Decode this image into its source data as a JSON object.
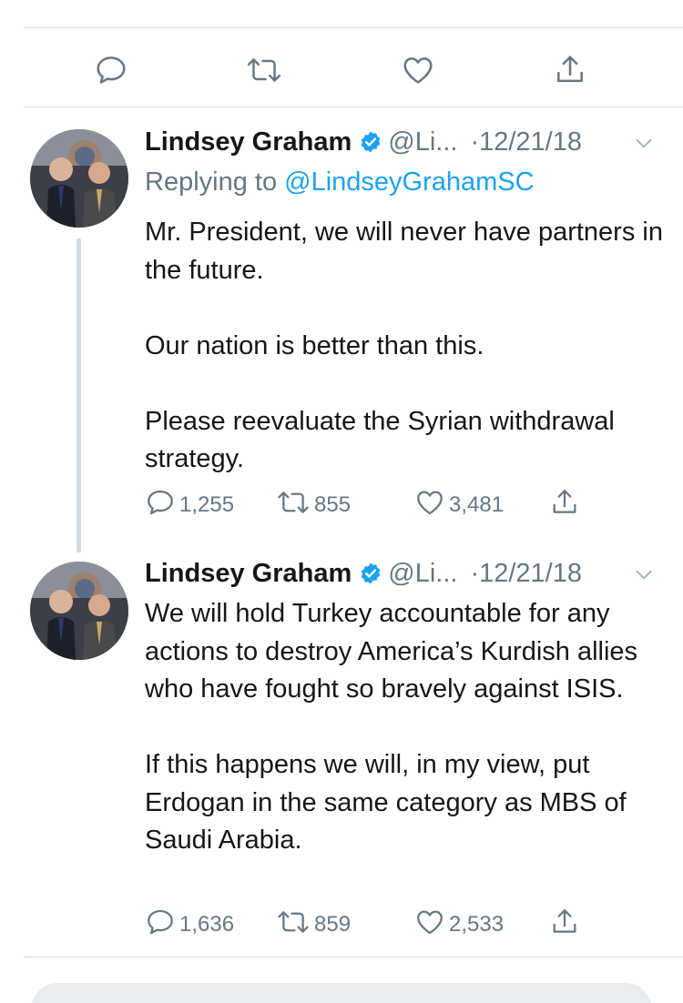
{
  "top_actions": {
    "icons": [
      "reply-icon",
      "retweet-icon",
      "like-icon",
      "share-icon"
    ]
  },
  "tweets": [
    {
      "name": "Lindsey Graham",
      "handle": "@Li...",
      "dot": "·",
      "date": "12/21/18",
      "replying_prefix": "Replying to ",
      "replying_to": "@LindseyGrahamSC",
      "paragraphs": [
        "Mr. President, we will never have partners in the future.",
        "Our nation is better than this.",
        "Please reevaluate the Syrian withdrawal strategy."
      ],
      "replies": "1,255",
      "retweets": "855",
      "likes": "3,481"
    },
    {
      "name": "Lindsey Graham",
      "handle": "@Li...",
      "dot": "·",
      "date": "12/21/18",
      "paragraphs": [
        "We will hold Turkey accountable for any actions to destroy America’s Kurdish allies who have fought so bravely against ISIS.",
        "If this happens we will, in my view, put Erdogan in the same category as MBS of Saudi Arabia."
      ],
      "replies": "1,636",
      "retweets": "859",
      "likes": "2,533"
    }
  ],
  "colors": {
    "text": "#14171a",
    "secondary": "#657786",
    "link": "#1da1f2",
    "divider": "#d5d9dd",
    "thread_line": "#cfd9de"
  }
}
